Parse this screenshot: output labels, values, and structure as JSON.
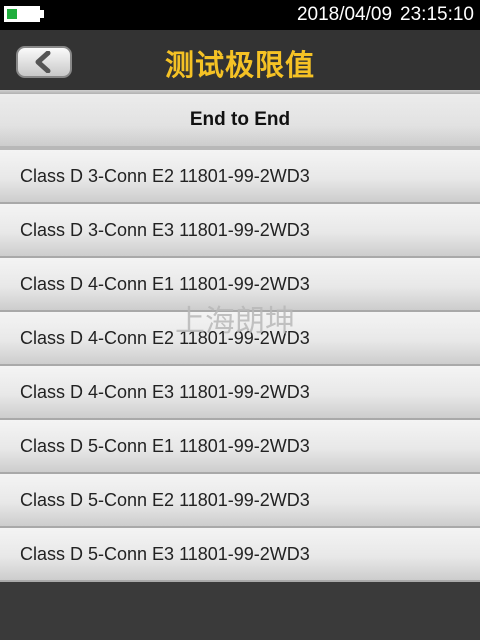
{
  "status_bar": {
    "date": "2018/04/09",
    "time": "23:15:10",
    "battery_level": 0.3,
    "battery_color": "#1fae3c"
  },
  "header": {
    "title": "测试极限值",
    "title_color": "#f5c225",
    "back_icon": "chevron-left-icon"
  },
  "section": {
    "label": "End to End"
  },
  "list": {
    "items": [
      "Class D 3-Conn E2 11801-99-2WD3",
      "Class D 3-Conn E3 11801-99-2WD3",
      "Class D 4-Conn E1 11801-99-2WD3",
      "Class D 4-Conn E2 11801-99-2WD3",
      "Class D 4-Conn E3 11801-99-2WD3",
      "Class D 5-Conn E1 11801-99-2WD3",
      "Class D 5-Conn E2 11801-99-2WD3",
      "Class D 5-Conn E3 11801-99-2WD3"
    ]
  },
  "watermark": "上海朗坤"
}
